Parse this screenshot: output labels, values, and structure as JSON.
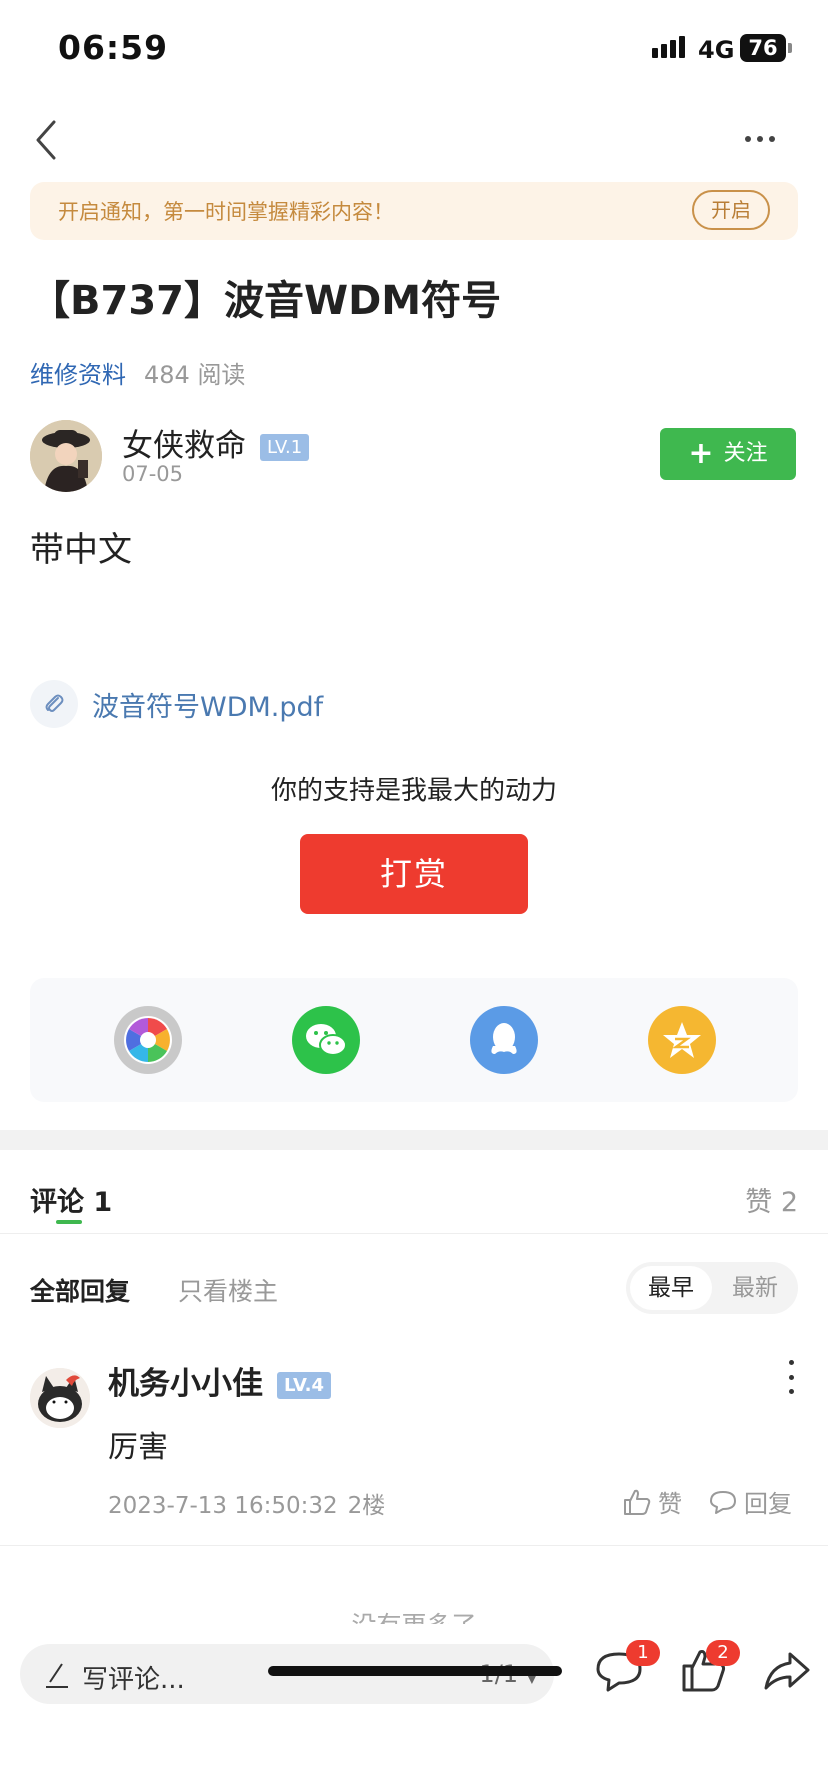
{
  "status_bar": {
    "time": "06:59",
    "network": "4G",
    "battery": "76"
  },
  "notice": {
    "text": "开启通知，第一时间掌握精彩内容！",
    "button": "开启"
  },
  "post": {
    "title": "【B737】波音WDM符号",
    "category": "维修资料",
    "reads": "484 阅读",
    "author": {
      "name": "女侠救命",
      "level": "LV.1",
      "date": "07-05"
    },
    "follow_label": "关注",
    "body": "带中文",
    "attachment": "波音符号WDM.pdf"
  },
  "reward": {
    "tagline": "你的支持是我最大的动力",
    "button": "打赏"
  },
  "share": {
    "icons": [
      "camera-aperture-icon",
      "wechat-icon",
      "qq-icon",
      "qzone-icon"
    ],
    "colors": {
      "aperture": "#c7c7c7",
      "wechat": "#2dc24a",
      "qq": "#5b9be6",
      "qzone": "#f5b731"
    }
  },
  "comments_header": {
    "comments_label": "评论",
    "comments_count": "1",
    "likes_label": "赞",
    "likes_count": "2"
  },
  "filters": {
    "all": "全部回复",
    "op_only": "只看楼主",
    "sort_early": "最早",
    "sort_new": "最新"
  },
  "comments": [
    {
      "name": "机务小小佳",
      "level": "LV.4",
      "text": "厉害",
      "time": "2023-7-13 16:50:32",
      "floor": "2楼",
      "like_label": "赞",
      "reply_label": "回复"
    }
  ],
  "no_more": "没有更多了",
  "bottom_bar": {
    "placeholder": "写评论...",
    "page": "1/1",
    "comment_badge": "1",
    "like_badge": "2"
  },
  "theme": {
    "accent_green": "#3fb84f",
    "reward_red": "#ee3b2f",
    "link_blue": "#2f67b3"
  }
}
